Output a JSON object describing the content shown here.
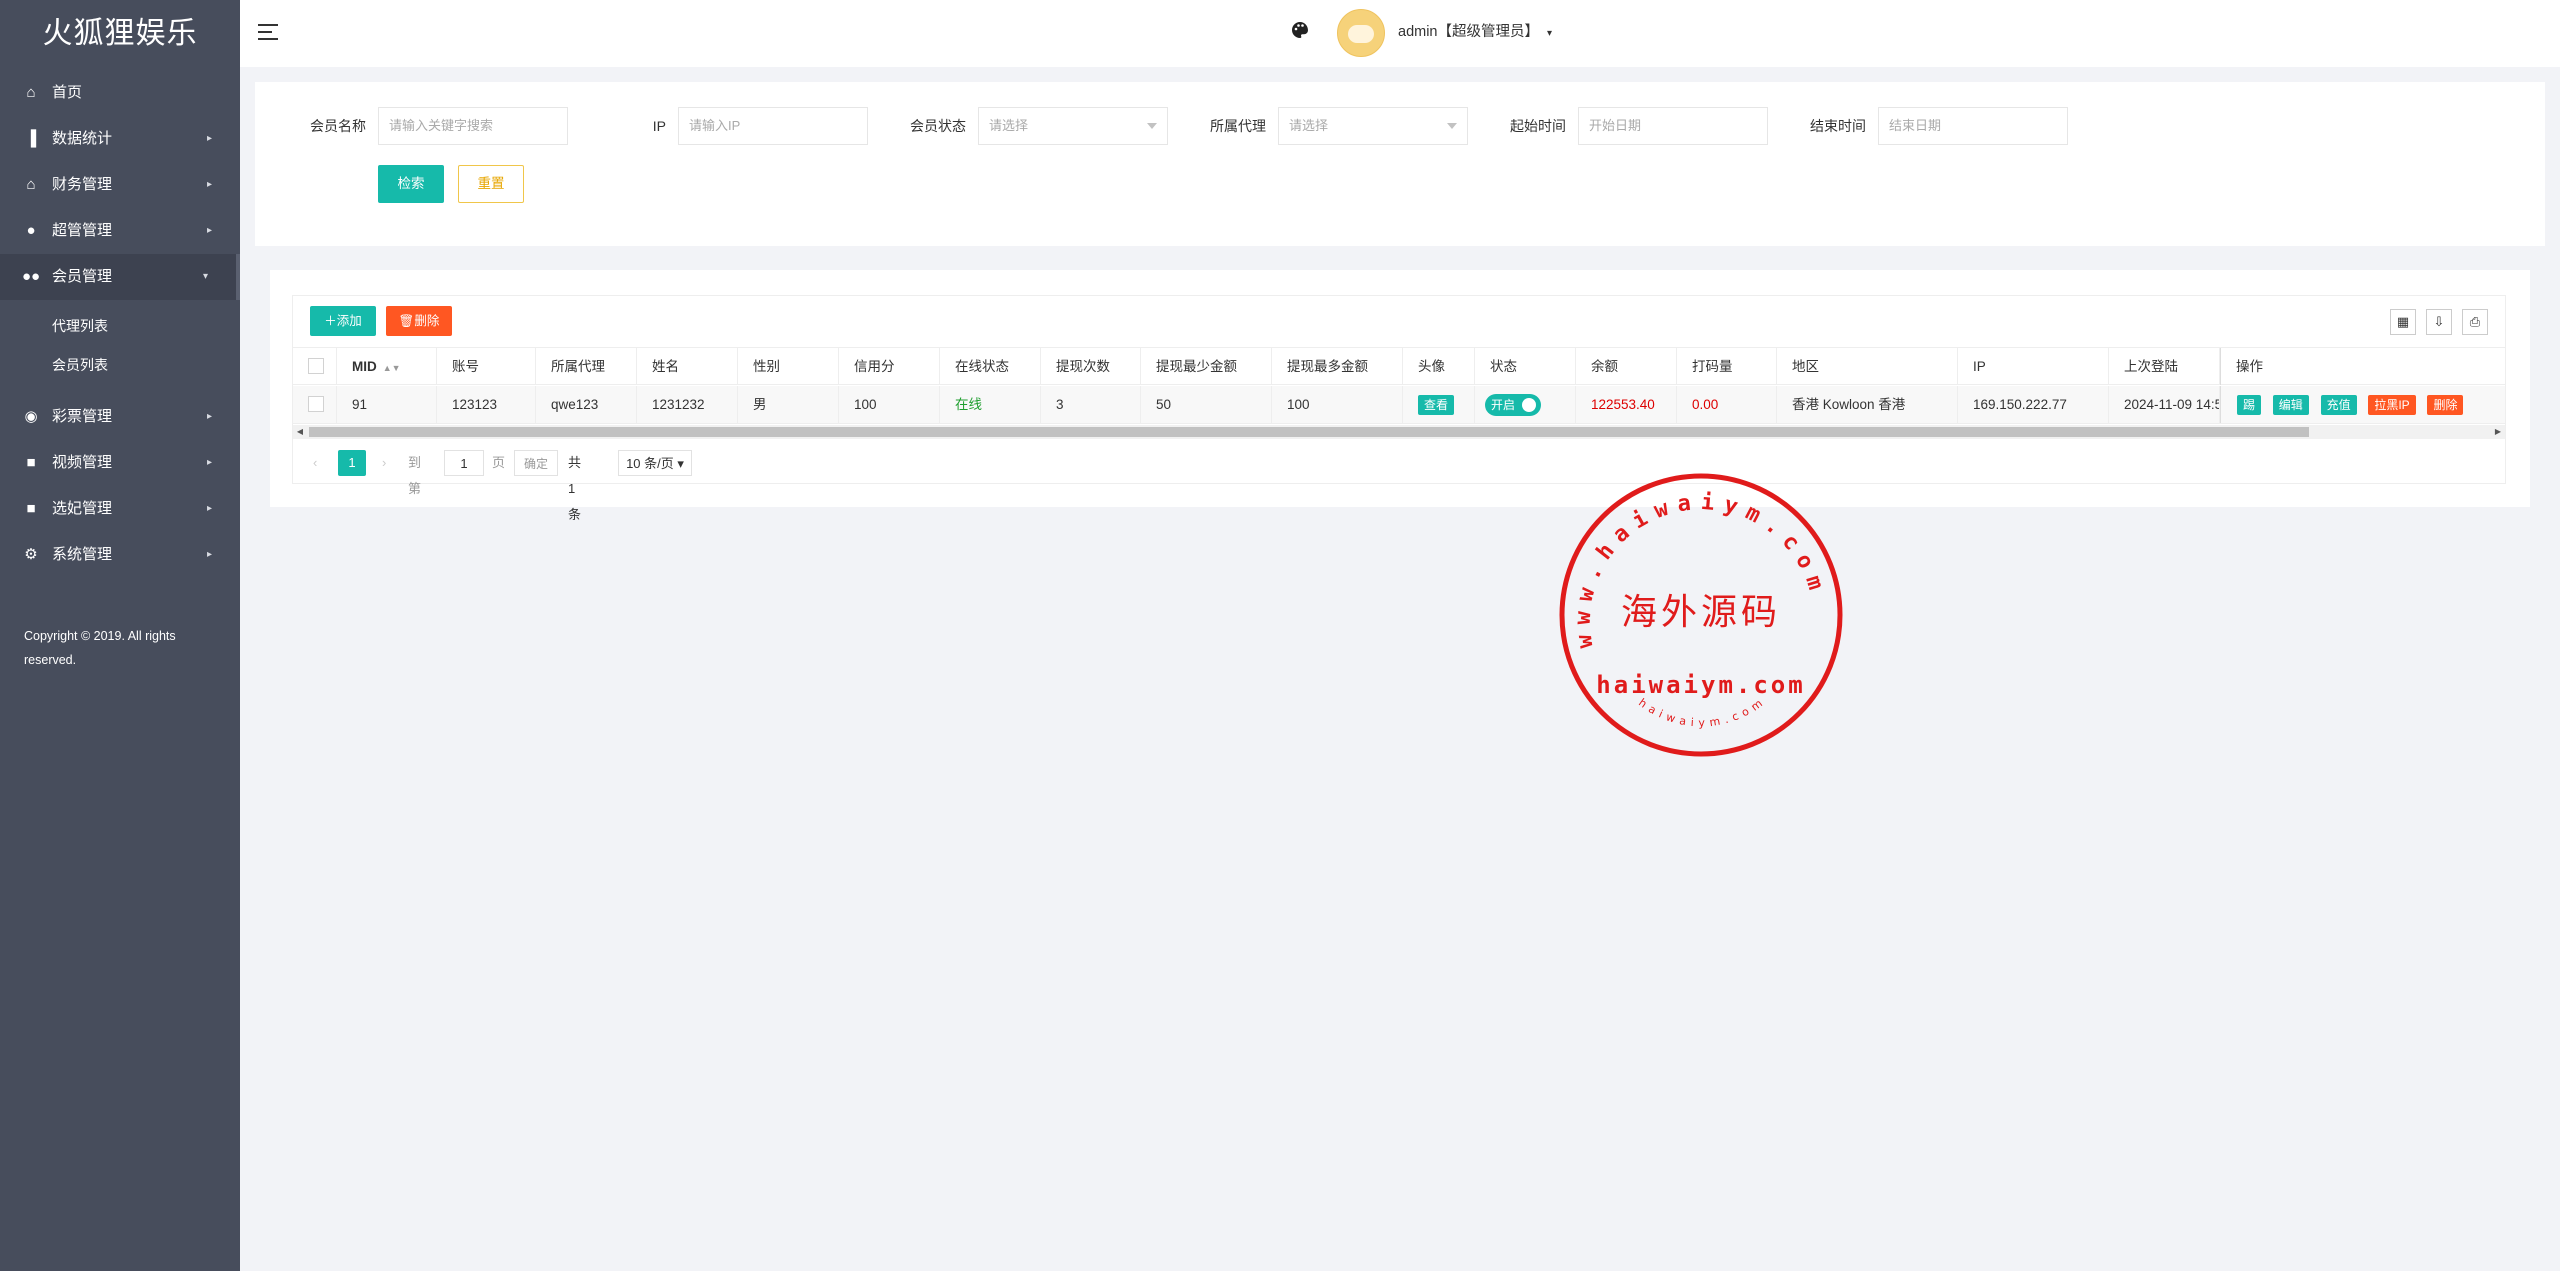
{
  "app": {
    "title": "火狐狸娱乐"
  },
  "sidebar": {
    "items": [
      {
        "label": "首页",
        "icon": "home-icon"
      },
      {
        "label": "数据统计",
        "icon": "bar-chart-icon"
      },
      {
        "label": "财务管理",
        "icon": "bank-icon"
      },
      {
        "label": "超管管理",
        "icon": "user-icon"
      },
      {
        "label": "会员管理",
        "icon": "users-icon"
      },
      {
        "label": "彩票管理",
        "icon": "gamepad-icon"
      },
      {
        "label": "视频管理",
        "icon": "video-icon"
      },
      {
        "label": "选妃管理",
        "icon": "video-icon"
      },
      {
        "label": "系统管理",
        "icon": "gear-icon"
      }
    ],
    "sub_items": [
      {
        "label": "代理列表"
      },
      {
        "label": "会员列表"
      }
    ],
    "copyright": "Copyright © 2019. All rights reserved."
  },
  "header": {
    "user": "admin【超级管理员】"
  },
  "filters": {
    "member_name": {
      "label": "会员名称",
      "placeholder": "请输入关键字搜索"
    },
    "ip": {
      "label": "IP",
      "placeholder": "请输入IP"
    },
    "status": {
      "label": "会员状态",
      "placeholder": "请选择"
    },
    "agent": {
      "label": "所属代理",
      "placeholder": "请选择"
    },
    "start": {
      "label": "起始时间",
      "placeholder": "开始日期"
    },
    "end": {
      "label": "结束时间",
      "placeholder": "结束日期"
    },
    "search_label": "检索",
    "reset_label": "重置"
  },
  "toolbar": {
    "add_label": "添加",
    "delete_label": "删除"
  },
  "table": {
    "columns": [
      "MID",
      "账号",
      "所属代理",
      "姓名",
      "性别",
      "信用分",
      "在线状态",
      "提现次数",
      "提现最少金额",
      "提现最多金额",
      "头像",
      "状态",
      "余额",
      "打码量",
      "地区",
      "IP",
      "上次登陆",
      "操作"
    ],
    "rows": [
      {
        "mid": "91",
        "account": "123123",
        "agent": "qwe123",
        "name": "1231232",
        "gender": "男",
        "credit": "100",
        "online": "在线",
        "withdraw_count": "3",
        "withdraw_min": "50",
        "withdraw_max": "100",
        "avatar_btn": "查看",
        "status": "开启",
        "balance": "122553.40",
        "bet_volume": "0.00",
        "region": "香港 Kowloon 香港",
        "ip": "169.150.222.77",
        "last_login": "2024-11-09 14:5",
        "actions": [
          "踢",
          "编辑",
          "充值",
          "拉黑IP",
          "删除"
        ]
      }
    ]
  },
  "pagination": {
    "current": "1",
    "goto_label": "到第",
    "page_input": "1",
    "page_label": "页",
    "confirm_label": "确定",
    "total": "共 1 条",
    "page_size": "10 条/页"
  },
  "watermark": {
    "arc_text": "www.haiwaiym.com",
    "center": "海外源码",
    "domain": "haiwaiym.com",
    "bottom_arc": "haiwaiym.com"
  },
  "colors": {
    "primary": "#16baaa",
    "danger": "#ff5722",
    "sidebar": "#474d5c",
    "warning": "#f0c64a"
  }
}
